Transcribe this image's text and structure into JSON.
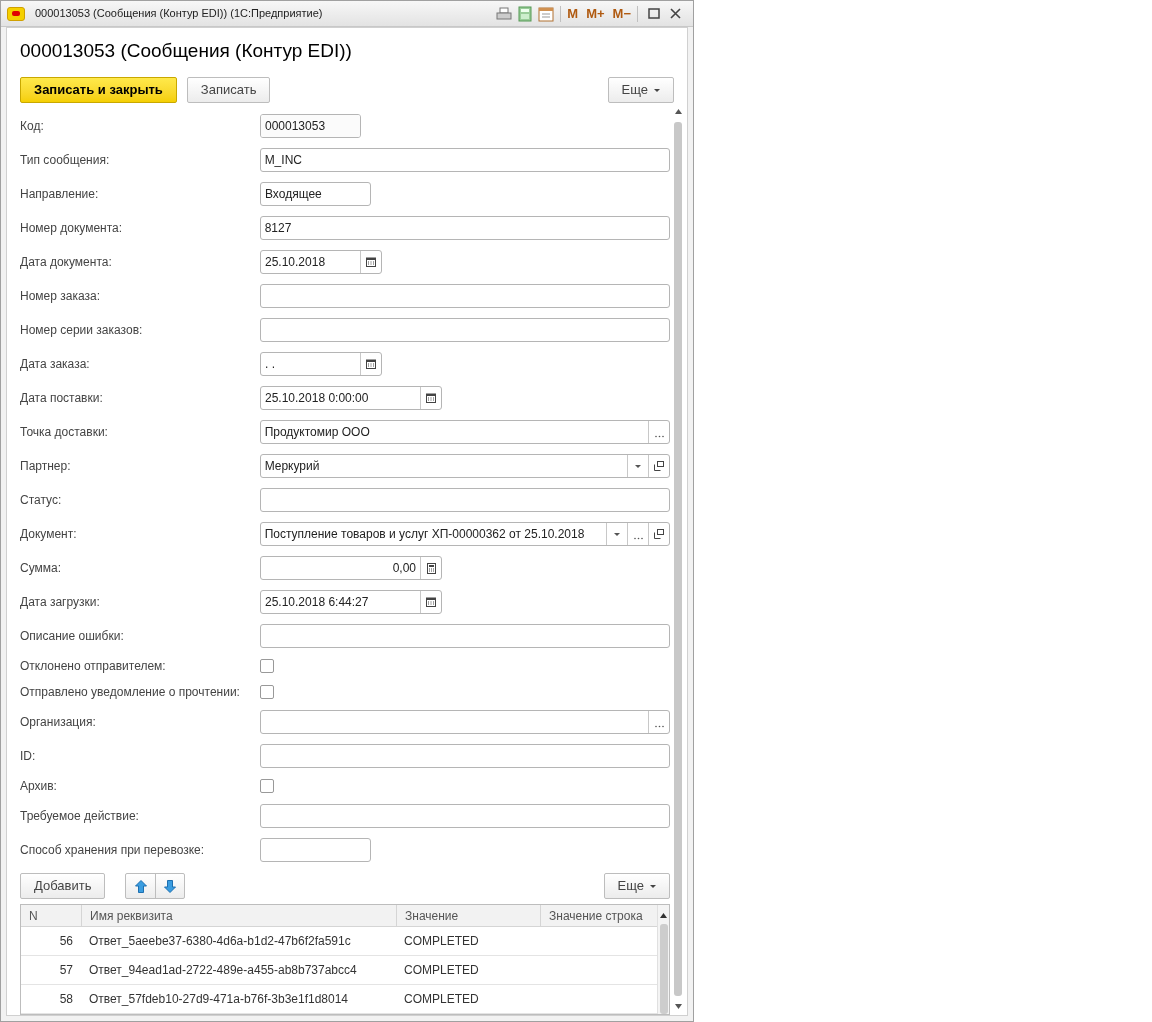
{
  "window": {
    "title": "000013053 (Сообщения (Контур EDI))  (1С:Предприятие)",
    "toolbar": [
      "M",
      "M+",
      "M−"
    ]
  },
  "form": {
    "title": "000013053 (Сообщения (Контур EDI))",
    "buttons": [
      {
        "label": "Записать и закрыть",
        "kind": "primary"
      },
      {
        "label": "Записать",
        "kind": "normal"
      }
    ],
    "more": "Еще"
  },
  "fields": [
    {
      "label": "Код:",
      "kind": "code",
      "value": "000013053"
    },
    {
      "label": "Тип сообщения:",
      "kind": "text",
      "value": "M_INC"
    },
    {
      "label": "Направление:",
      "kind": "enum",
      "value": "Входящее"
    },
    {
      "label": "Номер документа:",
      "kind": "text",
      "value": "8127"
    },
    {
      "label": "Дата документа:",
      "kind": "date",
      "value": "25.10.2018"
    },
    {
      "label": "Номер заказа:",
      "kind": "text"
    },
    {
      "label": "Номер серии заказов:",
      "kind": "text"
    },
    {
      "label": "Дата заказа:",
      "kind": "date",
      "value": " .  ."
    },
    {
      "label": "Дата поставки:",
      "kind": "datetime",
      "value": "25.10.2018  0:00:00"
    },
    {
      "label": "Точка доставки:",
      "kind": "ref",
      "value": "Продуктомир ООО"
    },
    {
      "label": "Партнер:",
      "kind": "select",
      "value": "Меркурий"
    },
    {
      "label": "Статус:",
      "kind": "text"
    },
    {
      "label": "Документ:",
      "kind": "ref_select",
      "value": "Поступление товаров и услуг ХП-00000362 от 25.10.2018"
    },
    {
      "label": "Сумма:",
      "kind": "number",
      "value": "0,00"
    },
    {
      "label": "Дата загрузки:",
      "kind": "datetime",
      "value": "25.10.2018  6:44:27"
    },
    {
      "label": "Описание ошибки:",
      "kind": "text"
    },
    {
      "label": "Отклонено отправителем:",
      "kind": "checkbox",
      "checked": false
    },
    {
      "label": "Отправлено уведомление о прочтении:",
      "kind": "checkbox",
      "checked": false
    },
    {
      "label": "Организация:",
      "kind": "ref"
    },
    {
      "label": "ID:",
      "kind": "text"
    },
    {
      "label": "Архив:",
      "kind": "checkbox",
      "checked": false
    },
    {
      "label": "Требуемое действие:",
      "kind": "text"
    },
    {
      "label": "Способ хранения при перевозке:",
      "kind": "enum"
    }
  ],
  "table_toolbar": {
    "add": "Добавить",
    "more": "Еще"
  },
  "table": {
    "columns": [
      "N",
      "Имя реквизита",
      "Значение",
      "Значение строка"
    ],
    "rows": [
      {
        "n": "56",
        "name": "Ответ_5aeebe37-6380-4d6a-b1d2-47b6f2fa591c",
        "value": "COMPLETED"
      },
      {
        "n": "57",
        "name": "Ответ_94ead1ad-2722-489e-a455-ab8b737abcc4",
        "value": "COMPLETED"
      },
      {
        "n": "58",
        "name": "Ответ_57fdeb10-27d9-471a-b76f-3b3e1f1d8014",
        "value": "COMPLETED"
      }
    ]
  }
}
